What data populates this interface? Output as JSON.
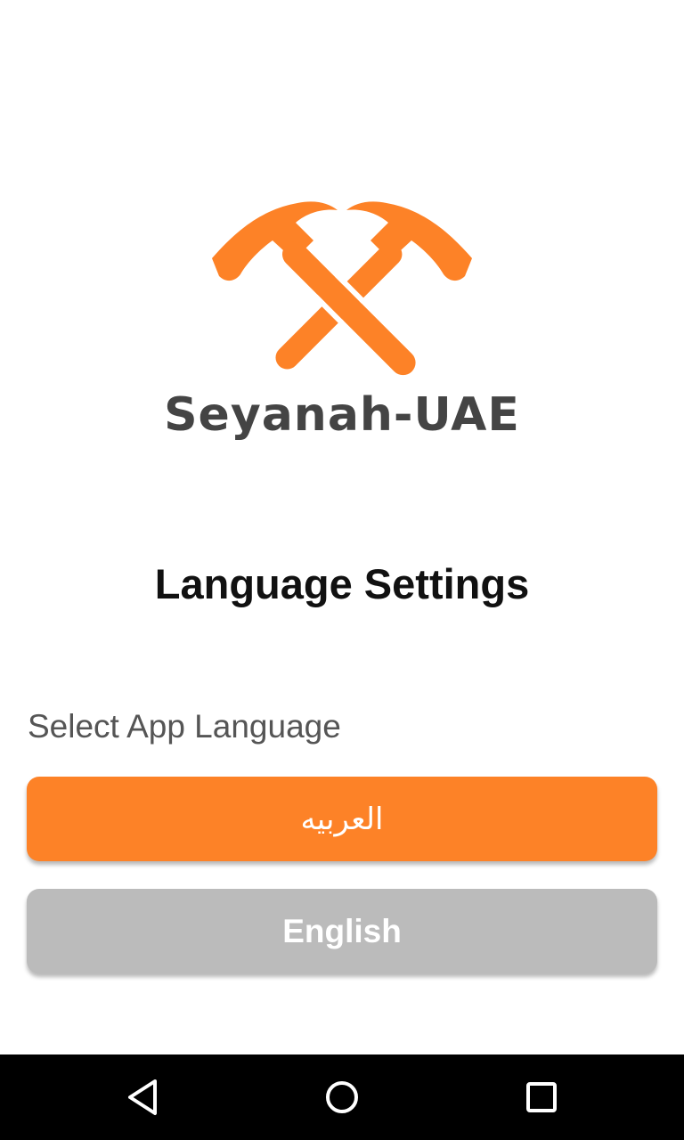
{
  "app": {
    "name": "Seyanah-UAE",
    "logo_icon": "crossed-hammers-icon",
    "brand_color": "#fd8227"
  },
  "page": {
    "title": "Language Settings",
    "section_label": "Select App Language"
  },
  "languages": {
    "arabic_label": "العربيه",
    "english_label": "English",
    "arabic_color": "#fd8227",
    "english_color": "#bbbbbb"
  },
  "navbar": {
    "back_icon": "back-triangle-icon",
    "home_icon": "home-circle-icon",
    "recents_icon": "recents-square-icon"
  }
}
